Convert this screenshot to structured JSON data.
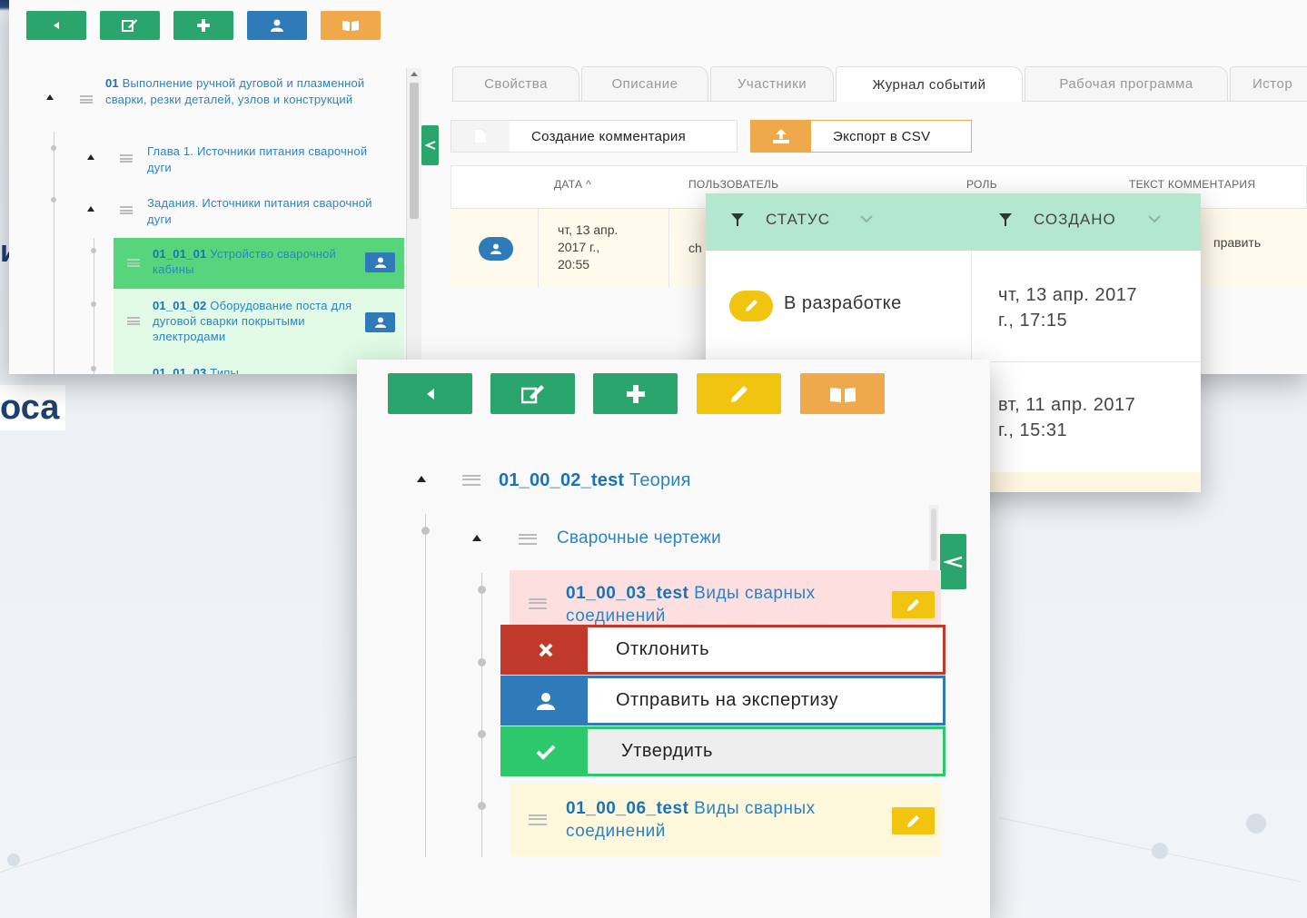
{
  "colors": {
    "green": "#2aa66d",
    "blue": "#2f7ab8",
    "orange": "#efa94a",
    "yellow": "#f1c40f",
    "red": "#c0392b",
    "link": "#2b84c6"
  },
  "background_fragments": {
    "left_letter": "и",
    "left_word": "оса"
  },
  "main_window": {
    "toolbar": [
      {
        "name": "back-button",
        "icon": "caret-left-icon"
      },
      {
        "name": "edit-button",
        "icon": "pencil-square-icon"
      },
      {
        "name": "add-button",
        "icon": "plus-icon"
      },
      {
        "name": "user-button",
        "icon": "user-icon"
      },
      {
        "name": "book-button",
        "icon": "book-icon"
      }
    ],
    "tree": {
      "root": {
        "code": "01",
        "text": " Выполнение ручной дуговой и плазменной сварки, резки деталей, узлов и конструкций"
      },
      "chapter": "Глава 1. Источники питания сварочной дуги",
      "tasks": "Задания. Источники питания сварочной дуги",
      "items": [
        {
          "code": "01_01_01",
          "text": " Устройство сварочной кабины"
        },
        {
          "code": "01_01_02",
          "text": " Оборудование поста для дуговой сварки покрытыми электродами"
        },
        {
          "code": "01_01_03",
          "text": " Типы"
        }
      ]
    },
    "tabs": [
      "Свойства",
      "Описание",
      "Участники",
      "Журнал событий",
      "Рабочая программа",
      "Истор"
    ],
    "active_tab": "Журнал событий",
    "actions": {
      "create_comment": "Создание комментария",
      "export_csv": "Экспорт в CSV"
    },
    "table": {
      "headers": [
        "ДАТА",
        "ПОЛЬЗОВАТЕЛЬ",
        "РОЛЬ",
        "ТЕКСТ КОММЕНТАРИЯ"
      ],
      "sort_indicator": "^",
      "row": {
        "date_line1": "чт, 13 апр.",
        "date_line2": "2017 г.,",
        "date_line3": "20:55",
        "user": "ch",
        "comment": "править"
      }
    }
  },
  "status_popup": {
    "headers": {
      "status": "СТАТУС",
      "created": "СОЗДАНО"
    },
    "rows": [
      {
        "status": "В разработке",
        "date_line1": "чт, 13 апр. 2017",
        "date_line2": "г., 17:15"
      },
      {
        "status": "",
        "date_line1": "вт, 11 апр. 2017",
        "date_line2": "г., 15:31"
      }
    ]
  },
  "front_window": {
    "toolbar": [
      {
        "name": "back-button",
        "icon": "caret-left-icon"
      },
      {
        "name": "edit-button",
        "icon": "pencil-square-icon"
      },
      {
        "name": "add-button",
        "icon": "plus-icon"
      },
      {
        "name": "pencil-button",
        "icon": "pencil-icon"
      },
      {
        "name": "book-button",
        "icon": "book-icon"
      }
    ],
    "tree": {
      "root": {
        "code": "01_00_02_test",
        "text": " Теория"
      },
      "section": "Сварочные чертежи",
      "items": [
        {
          "code": "01_00_03_test",
          "text": " Виды сварных соединений"
        },
        {
          "code": "01_00_06_test",
          "text": " Виды сварных соединений"
        }
      ]
    },
    "menu": {
      "reject": "Отклонить",
      "send_expertise": "Отправить на экспертизу",
      "approve": "Утвердить"
    }
  }
}
